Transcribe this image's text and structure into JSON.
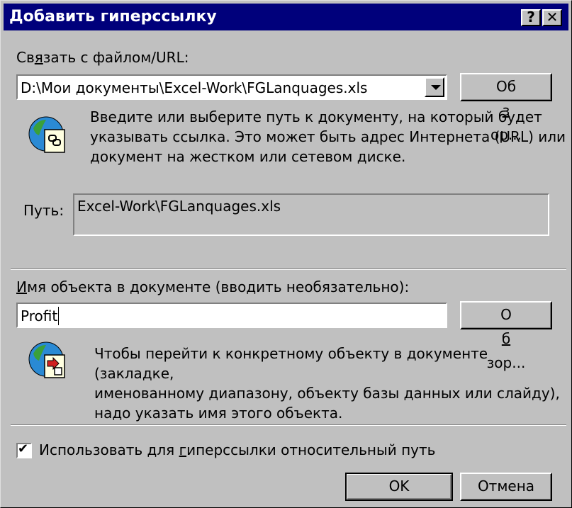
{
  "window": {
    "title": "Добавить гиперссылку",
    "help_glyph": "?",
    "close_glyph": "✕"
  },
  "link_section": {
    "label_pre": "Св",
    "label_hot": "я",
    "label_post": "зать с файлом/URL:",
    "combo_value": "D:\\Мои документы\\Excel-Work\\FGLanquages.xls",
    "browse_pre": "Об",
    "browse_hot": "з",
    "browse_post": "ор...",
    "icon": "link-document-icon",
    "description_lines": [
      "Введите или выберите путь к документу, на который будет",
      "указывать ссылка.  Это может быть адрес Интернета (URL) или",
      "документ на жестком или сетевом диске."
    ],
    "path_label": "Путь:",
    "path_value": "Excel-Work\\FGLanquages.xls"
  },
  "object_section": {
    "label_hot": "И",
    "label_post": "мя объекта в документе (вводить необязательно):",
    "input_value": "Profit",
    "browse_pre": "О",
    "browse_hot": "б",
    "browse_post": "зор...",
    "icon": "named-object-icon",
    "description_lines": [
      "Чтобы перейти к конкретному объекту в документе (закладке,",
      "именованному диапазону, объекту базы данных или слайду),",
      "надо указать имя этого объекта."
    ]
  },
  "relative_path": {
    "checked": true,
    "check_glyph": "✔",
    "label_pre": "Использовать для ",
    "label_hot": "г",
    "label_post": "иперссылки относительный путь"
  },
  "buttons": {
    "ok": "OK",
    "cancel": "Отмена"
  },
  "colors": {
    "titlebar": "#00007b",
    "face": "#c0c0c0"
  }
}
